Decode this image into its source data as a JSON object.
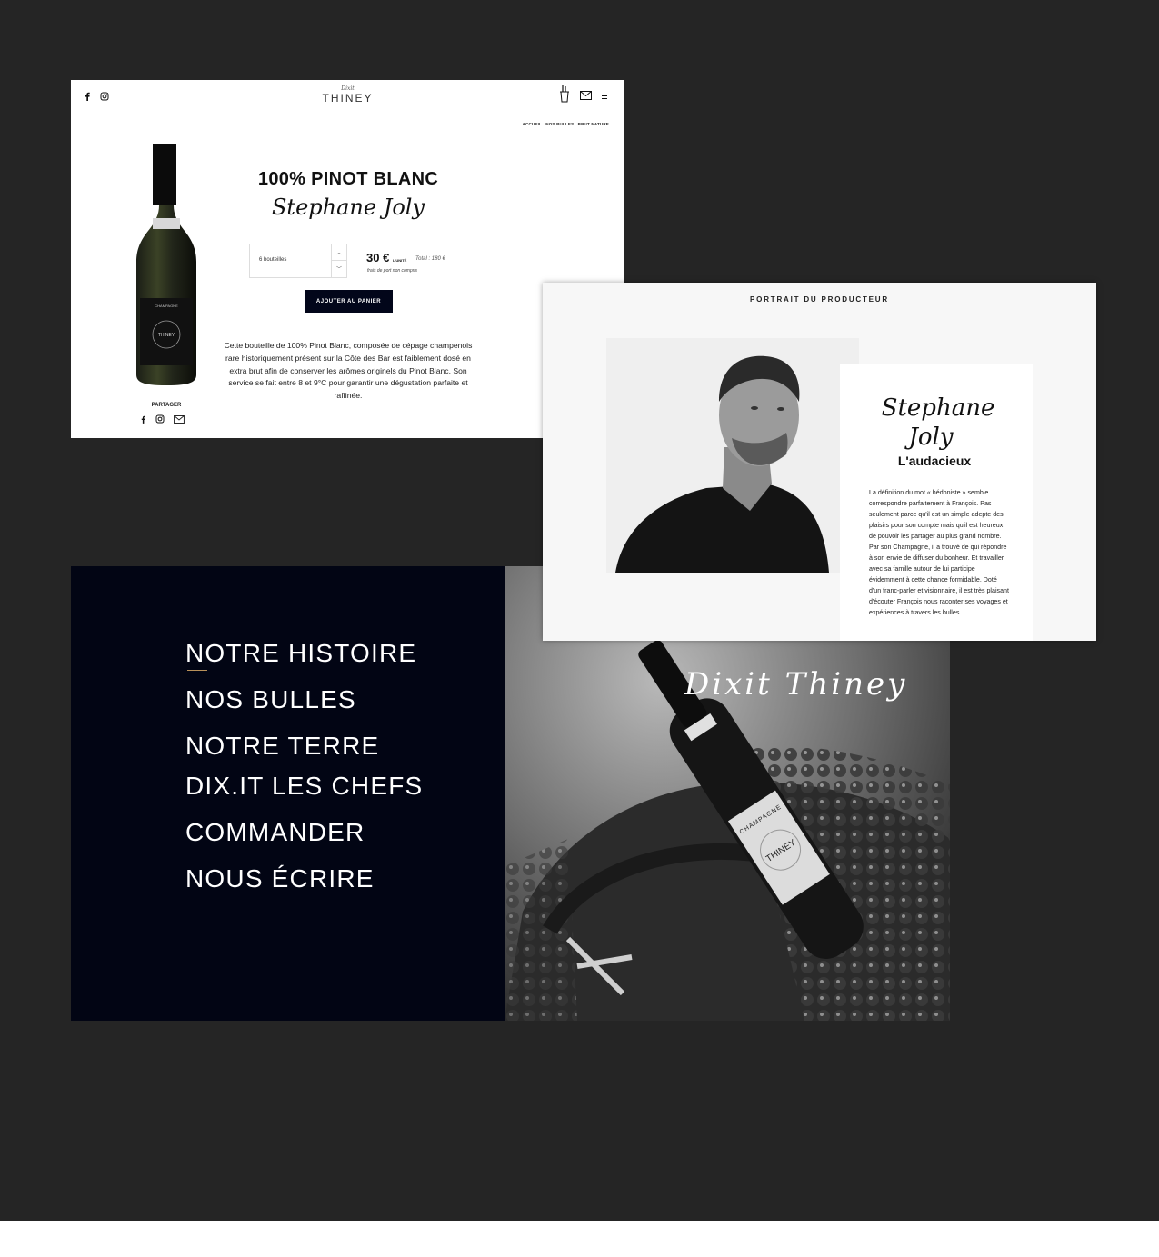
{
  "product_page": {
    "brand": {
      "script": "Dixit",
      "name": "THINEY"
    },
    "social_icons": [
      "facebook-icon",
      "instagram-icon"
    ],
    "header_icons": [
      "ice-bucket-icon",
      "mail-icon",
      "menu-icon"
    ],
    "breadcrumb": "ACCUEIL . NOS BULLES . BRUT NATURE",
    "title": "100% PINOT BLANC",
    "signature": "Stephane Joly",
    "quantity_value": "6 bouteilles",
    "price": "30 €",
    "price_unit": "L'UNITÉ",
    "total": "Total : 180 €",
    "shipping_note": "frais de port non compris",
    "add_to_cart_label": "AJOUTER AU PANIER",
    "description": "Cette bouteille de 100% Pinot Blanc, composée de cépage champenois rare historiquement présent sur la Côte des Bar est faiblement dosé en extra brut afin de conserver les arômes originels du Pinot Blanc. Son service se fait entre 8 et 9°C pour garantir une dégustation parfaite et raffinée.",
    "share_label": "PARTAGER",
    "share_icons": [
      "facebook-icon",
      "instagram-icon",
      "mail-icon"
    ],
    "bottle_label": {
      "top": "CHAMPAGNE",
      "brand": "THINEY"
    }
  },
  "producer": {
    "heading": "PORTRAIT DU PRODUCTEUR",
    "signature_line1": "Stephane",
    "signature_line2": "Joly",
    "subtitle": "L'audacieux",
    "bio": "La définition du mot « hédoniste » semble correspondre parfaitement à François. Pas seulement parce qu'il est un simple adepte des plaisirs pour son compte mais qu'il est heureux de pouvoir les partager au plus grand nombre. Par son Champagne, il a trouvé de qui répondre à son envie de diffuser du bonheur. Et travailler avec sa famille autour de lui participe évidemment à cette chance formidable. Doté d'un franc-parler et visionnaire, il est très plaisant d'écouter François nous raconter ses voyages et expériences à travers les bulles."
  },
  "menu": {
    "items": [
      "NOTRE HISTOIRE",
      "NOS BULLES",
      "NOTRE TERRE",
      "DIX.IT LES CHEFS",
      "COMMANDER",
      "NOUS ÉCRIRE"
    ],
    "photo_caption": "Dixit Thiney",
    "bottle_label": {
      "top": "CHAMPAGNE",
      "brand": "THINEY"
    }
  },
  "colors": {
    "backdrop": "#252525",
    "navy": "#02061a",
    "accent": "#b8915a"
  }
}
